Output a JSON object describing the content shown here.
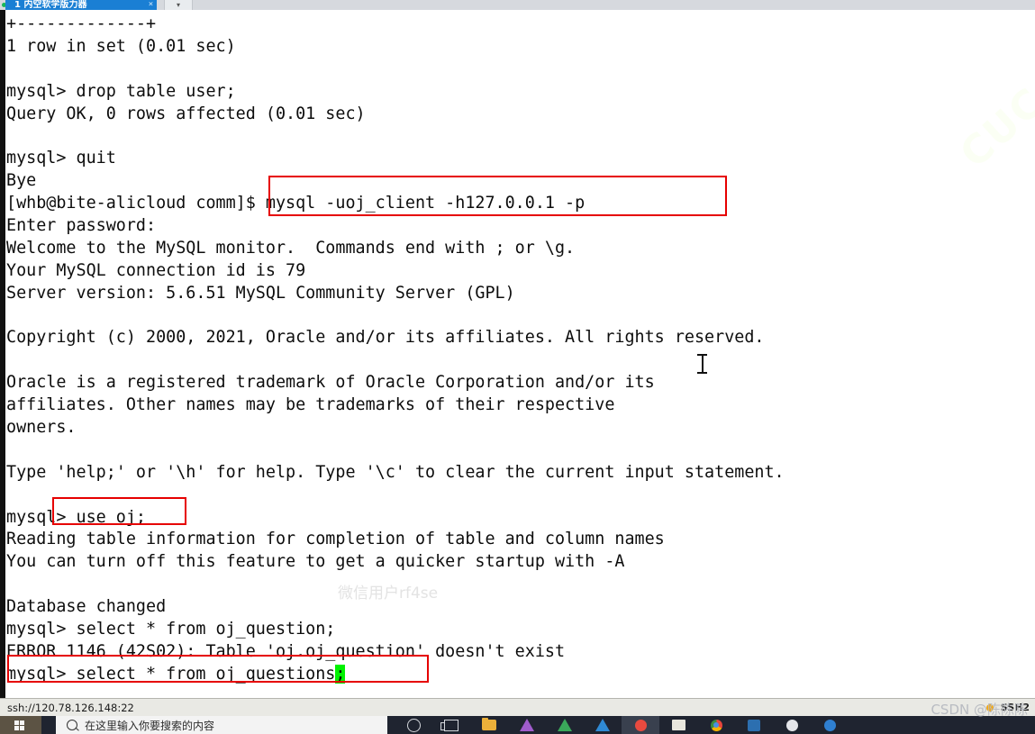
{
  "tabstrip": {
    "active_tab_label": "1 内空软学版力器",
    "close_icon": "×",
    "next_tab_label": "▾"
  },
  "terminal": {
    "lines": [
      "+-------------+",
      "1 row in set (0.01 sec)",
      "",
      "mysql> drop table user;",
      "Query OK, 0 rows affected (0.01 sec)",
      "",
      "mysql> quit",
      "Bye",
      "[whb@bite-alicloud comm]$ mysql -uoj_client -h127.0.0.1 -p",
      "Enter password:",
      "Welcome to the MySQL monitor.  Commands end with ; or \\g.",
      "Your MySQL connection id is 79",
      "Server version: 5.6.51 MySQL Community Server (GPL)",
      "",
      "Copyright (c) 2000, 2021, Oracle and/or its affiliates. All rights reserved.",
      "",
      "Oracle is a registered trademark of Oracle Corporation and/or its",
      "affiliates. Other names may be trademarks of their respective",
      "owners.",
      "",
      "Type 'help;' or '\\h' for help. Type '\\c' to clear the current input statement.",
      "",
      "mysql> use oj;",
      "Reading table information for completion of table and column names",
      "You can turn off this feature to get a quicker startup with -A",
      "",
      "Database changed",
      "mysql> select * from oj_question;",
      "ERROR 1146 (42S02): Table 'oj.oj_question' doesn't exist"
    ],
    "last_prompt_prefix": "mysql> select * from oj_questions",
    "cursor_char": ";",
    "cursor_color": "#00f100",
    "foreground_color": "#0d0d0d",
    "background_color": "#ffffff"
  },
  "annotations": {
    "redbox_color": "#e60000",
    "boxes": [
      {
        "name": "mysql-connect-command",
        "label": "$ mysql -uoj_client -h127.0.0.1 -p"
      },
      {
        "name": "use-oj-command",
        "label": "l> use oj;"
      },
      {
        "name": "select-oj-questions-command",
        "label": "mysql> select * from oj_questions;"
      }
    ]
  },
  "watermarks": {
    "center": "微信用户rf4se",
    "diagonal": "CUC",
    "csdn": "CSDN @陈陈陈"
  },
  "statusbar": {
    "ssh_url": "ssh://120.78.126.148:22",
    "protocol": "SSH2"
  },
  "taskbar": {
    "start_label": "windows-logo",
    "search_placeholder": "在这里输入你要搜索的内容",
    "icons": [
      "cortana-icon",
      "task-view-icon",
      "file-explorer-icon",
      "visual-studio-icon",
      "green-triangle-icon",
      "vscode-icon",
      "recording-icon",
      "notes-icon",
      "chrome-icon",
      "xshell-icon",
      "moon-icon",
      "blue-circle-icon"
    ]
  }
}
